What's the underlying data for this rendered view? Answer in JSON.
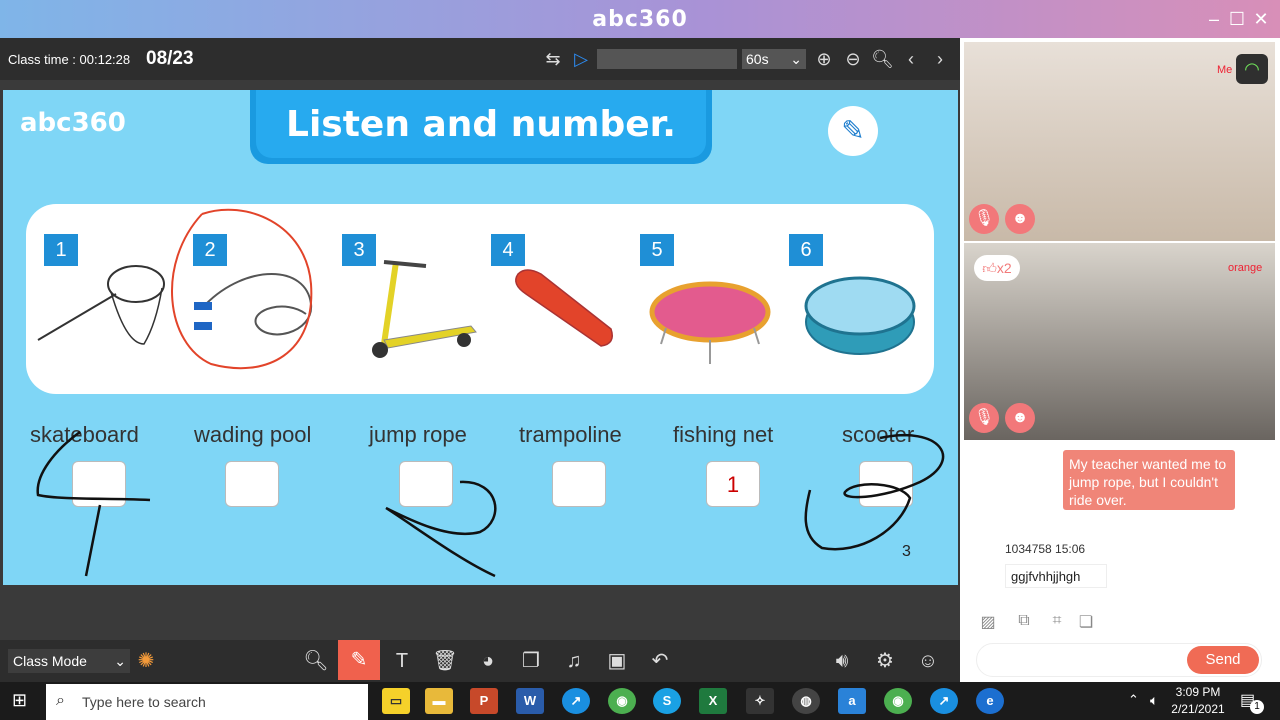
{
  "app": {
    "title": "abc360"
  },
  "toolbar": {
    "class_time": "Class time : 00:12:28",
    "page_counter": "08/23",
    "speed": "60s"
  },
  "slide": {
    "logo": "abc360",
    "title": "Listen and number.",
    "pictures": [
      "1",
      "2",
      "3",
      "4",
      "5",
      "6"
    ],
    "words": [
      "skateboard",
      "wading pool",
      "jump rope",
      "trampoline",
      "fishing net",
      "scooter"
    ],
    "answers": [
      "",
      "",
      "",
      "",
      "1",
      ""
    ],
    "page_number": "3"
  },
  "bottom": {
    "mode": "Class Mode"
  },
  "video": {
    "me_label": "Me",
    "student_label": "orange",
    "likes": "x2"
  },
  "chat": {
    "bubble": "My teacher wanted me to jump rope, but I couldn't ride over.",
    "meta": "1034758  15:06",
    "message": "ggjfvhhjjhgh",
    "send": "Send"
  },
  "taskbar": {
    "search_placeholder": "Type here to search",
    "time": "3:09 PM",
    "date": "2/21/2021",
    "notifications": "1"
  },
  "colors": {
    "accent": "#27aaef",
    "send": "#f06b55",
    "slide_bg": "#7fd6f6"
  }
}
